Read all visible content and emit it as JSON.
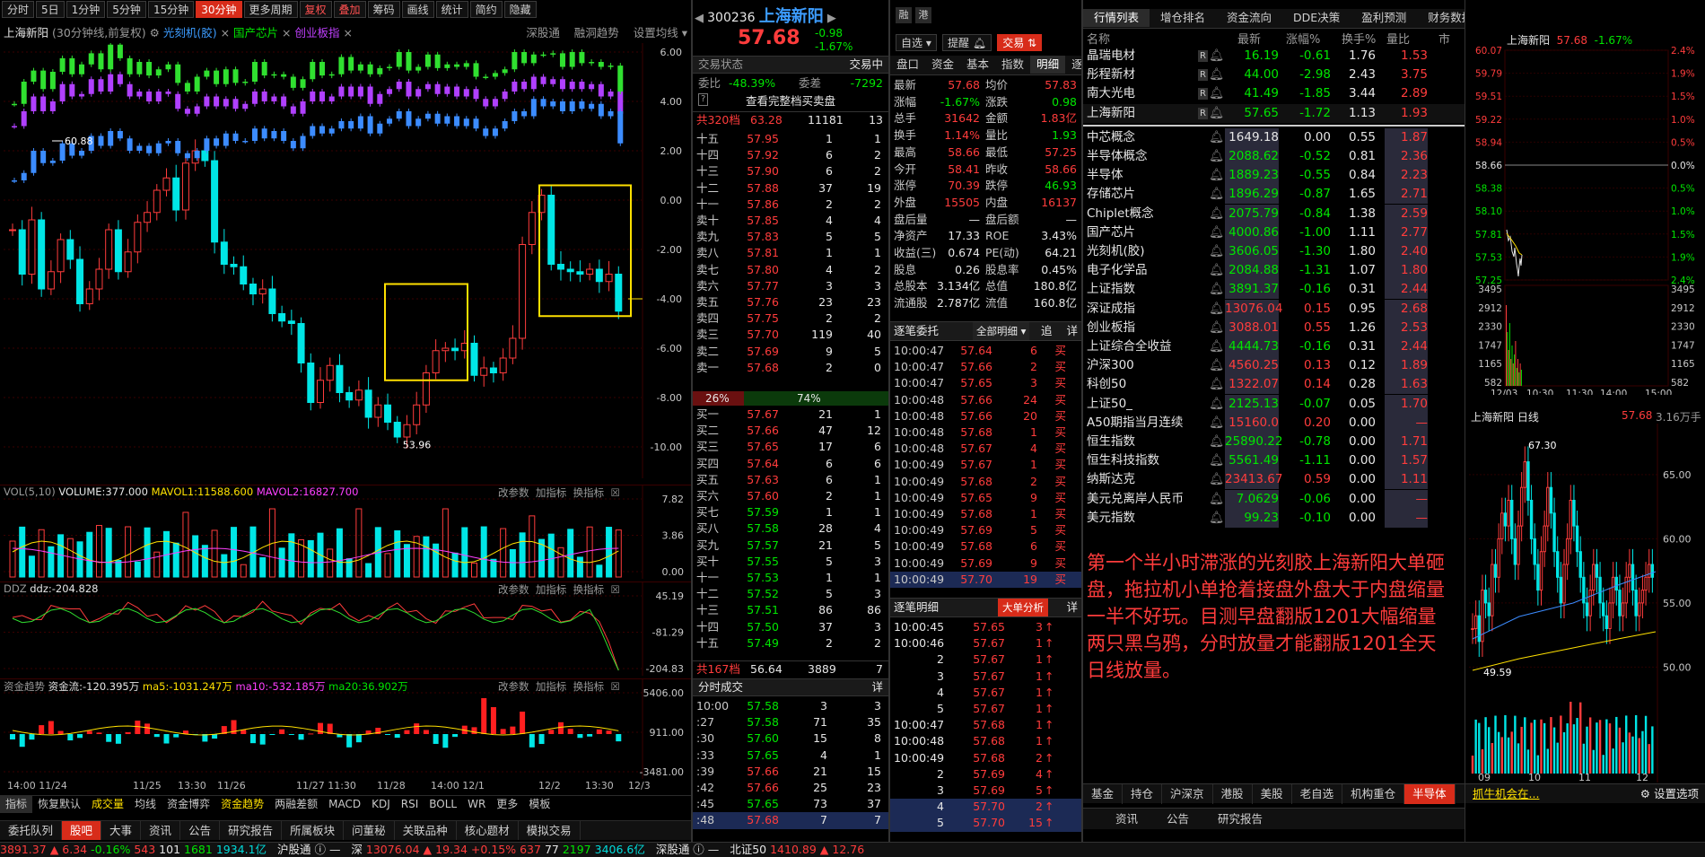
{
  "toolbar": {
    "periods": [
      "分时",
      "5日",
      "1分钟",
      "5分钟",
      "15分钟",
      "30分钟",
      "更多周期"
    ],
    "active_period": "30分钟",
    "adjust": "复权",
    "overlay": "叠加",
    "tools": [
      "筹码",
      "画线",
      "统计",
      "简约",
      "隐藏"
    ]
  },
  "chart_header": {
    "title": "上海新阳",
    "period_note": "(30分钟线,前复权)",
    "ovl1": "光刻机(胶)",
    "ovl2": "国产芯片",
    "ovl3": "创业板指",
    "links": [
      "深股通",
      "融洞趋势",
      "设置均线"
    ]
  },
  "price_axis": [
    "6.00",
    "4.00",
    "2.00",
    "0.00",
    "-2.00",
    "-4.00",
    "-6.00",
    "-8.00",
    "-10.00"
  ],
  "chart_labels": {
    "high": "60.88",
    "low": "53.96"
  },
  "vol": {
    "title": "VOL(5,10)",
    "volume": "VOLUME:377.000",
    "mavol1": "MAVOL1:11588.600",
    "mavol2": "MAVOL2:16827.700",
    "axis": [
      "7.82",
      "3.86",
      "0.00"
    ]
  },
  "ddz": {
    "title": "DDZ",
    "value": "ddz:-204.828",
    "axis": [
      "45.19",
      "-81.29",
      "-204.83"
    ]
  },
  "fund": {
    "title": "资金趋势",
    "flow": "资金流:-120.395万",
    "ma5": "ma5:-1031.247万",
    "ma10": "ma10:-532.185万",
    "ma20": "ma20:36.902万",
    "axis": [
      "5406.00",
      "911.00",
      "-3481.00"
    ]
  },
  "subpanel_links": [
    "改参数",
    "加指标",
    "换指标"
  ],
  "time_axis": [
    "14:00 11/24",
    "11/25",
    "13:30",
    "11/26",
    "11/27 11:30",
    "11/28",
    "14:00 12/1",
    "12/2",
    "13:30",
    "12/3"
  ],
  "indicator_tabs": [
    "指标",
    "恢复默认",
    "成交量",
    "均线",
    "资金博弈",
    "资金趋势",
    "两融差额",
    "MACD",
    "KDJ",
    "RSI",
    "BOLL",
    "WR",
    "更多",
    "模板"
  ],
  "bottom_tabs": [
    "委托队列",
    "股吧",
    "大事",
    "资讯",
    "公告",
    "研究报告",
    "所属板块",
    "问董秘",
    "关联品种",
    "核心题材",
    "模拟交易"
  ],
  "active_bottom_tab": "股吧",
  "stock": {
    "code": "300236",
    "name": "上海新阳",
    "tag1": "融",
    "tag2": "港",
    "price": "57.68",
    "chg": "-0.98",
    "pct": "-1.67%",
    "btn_select": "自选",
    "btn_alert": "提醒",
    "btn_trade": "交易"
  },
  "order_book": {
    "status_label": "交易状态",
    "status": "交易中",
    "wb_label": "委比",
    "wb": "-48.39%",
    "wc_label": "委差",
    "wc": "-7292",
    "full_book": "查看完整档买卖盘",
    "sell_total": {
      "label": "共320档",
      "price": "63.28",
      "vol": "11181",
      "n": "13"
    },
    "sells": [
      [
        "十五",
        "57.95",
        "1",
        "1"
      ],
      [
        "十四",
        "57.92",
        "6",
        "2"
      ],
      [
        "十三",
        "57.90",
        "6",
        "2"
      ],
      [
        "十二",
        "57.88",
        "37",
        "19"
      ],
      [
        "十一",
        "57.86",
        "2",
        "2"
      ],
      [
        "卖十",
        "57.85",
        "4",
        "4"
      ],
      [
        "卖九",
        "57.83",
        "5",
        "5"
      ],
      [
        "卖八",
        "57.81",
        "1",
        "1"
      ],
      [
        "卖七",
        "57.80",
        "4",
        "2"
      ],
      [
        "卖六",
        "57.77",
        "3",
        "3"
      ],
      [
        "卖五",
        "57.76",
        "23",
        "23"
      ],
      [
        "卖四",
        "57.75",
        "2",
        "2"
      ],
      [
        "卖三",
        "57.70",
        "119",
        "40"
      ],
      [
        "卖二",
        "57.69",
        "9",
        "5"
      ],
      [
        "卖一",
        "57.68",
        "2",
        "0"
      ]
    ],
    "ratio_left": "26%",
    "ratio_right": "74%",
    "ratio": 0.26,
    "buys": [
      [
        "买一",
        "57.67",
        "21",
        "1"
      ],
      [
        "买二",
        "57.66",
        "47",
        "12"
      ],
      [
        "买三",
        "57.65",
        "17",
        "6"
      ],
      [
        "买四",
        "57.64",
        "6",
        "6"
      ],
      [
        "买五",
        "57.63",
        "6",
        "1"
      ],
      [
        "买六",
        "57.60",
        "2",
        "1"
      ],
      [
        "买七",
        "57.59",
        "1",
        "1"
      ],
      [
        "买八",
        "57.58",
        "28",
        "4"
      ],
      [
        "买九",
        "57.57",
        "21",
        "5"
      ],
      [
        "买十",
        "57.55",
        "5",
        "3"
      ],
      [
        "十一",
        "57.53",
        "1",
        "1"
      ],
      [
        "十二",
        "57.52",
        "5",
        "3"
      ],
      [
        "十三",
        "57.51",
        "86",
        "86"
      ],
      [
        "十四",
        "57.50",
        "37",
        "3"
      ],
      [
        "十五",
        "57.49",
        "2",
        "2"
      ]
    ],
    "buy_total": {
      "label": "共167档",
      "price": "56.64",
      "vol": "3889",
      "n": "7"
    }
  },
  "ticks_title": "分时成交",
  "detail": "详",
  "ticks": [
    [
      "10:00",
      "57.58",
      "3",
      "3"
    ],
    [
      ":27",
      "57.58",
      "71",
      "35"
    ],
    [
      ":30",
      "57.60",
      "15",
      "8"
    ],
    [
      ":33",
      "57.65",
      "4",
      "1"
    ],
    [
      ":39",
      "57.66",
      "21",
      "15"
    ],
    [
      ":42",
      "57.66",
      "25",
      "23"
    ],
    [
      ":45",
      "57.65",
      "73",
      "37"
    ],
    [
      ":48",
      "57.68",
      "7",
      "7"
    ]
  ],
  "quote_tabs": [
    "盘口",
    "资金",
    "基本",
    "指数",
    "明细",
    "逐笔"
  ],
  "quote": [
    [
      "最新",
      "57.68",
      "均价",
      "57.83"
    ],
    [
      "涨幅",
      "-1.67%",
      "涨跌",
      "0.98"
    ],
    [
      "总手",
      "31642",
      "金额",
      "1.83亿"
    ],
    [
      "换手",
      "1.14%",
      "量比",
      "1.93"
    ],
    [
      "最高",
      "58.66",
      "最低",
      "57.25"
    ],
    [
      "今开",
      "58.41",
      "昨收",
      "58.66"
    ],
    [
      "涨停",
      "70.39",
      "跌停",
      "46.93"
    ],
    [
      "外盘",
      "15505",
      "内盘",
      "16137"
    ],
    [
      "盘后量",
      "—",
      "盘后额",
      "—"
    ],
    [
      "净资产",
      "17.33",
      "ROE",
      "3.43%"
    ],
    [
      "收益(三)",
      "0.674",
      "PE(动)",
      "64.21"
    ],
    [
      "股息",
      "0.26",
      "股息率",
      "0.45%"
    ],
    [
      "总股本",
      "3.134亿",
      "总值",
      "180.8亿"
    ],
    [
      "流通股",
      "2.787亿",
      "流值",
      "160.8亿"
    ]
  ],
  "entrust": {
    "title": "逐笔委托",
    "filter": "全部明细",
    "btn1": "追",
    "btn2": "详",
    "rows": [
      [
        "10:00:47",
        "57.64",
        "6",
        "买"
      ],
      [
        "10:00:47",
        "57.66",
        "2",
        "买"
      ],
      [
        "10:00:47",
        "57.65",
        "3",
        "买"
      ],
      [
        "10:00:48",
        "57.66",
        "24",
        "买"
      ],
      [
        "10:00:48",
        "57.66",
        "20",
        "买"
      ],
      [
        "10:00:48",
        "57.68",
        "1",
        "买"
      ],
      [
        "10:00:48",
        "57.67",
        "4",
        "买"
      ],
      [
        "10:00:49",
        "57.67",
        "1",
        "买"
      ],
      [
        "10:00:49",
        "57.68",
        "2",
        "买"
      ],
      [
        "10:00:49",
        "57.65",
        "9",
        "买"
      ],
      [
        "10:00:49",
        "57.68",
        "1",
        "买"
      ],
      [
        "10:00:49",
        "57.69",
        "5",
        "买"
      ],
      [
        "10:00:49",
        "57.68",
        "6",
        "买"
      ],
      [
        "10:00:49",
        "57.69",
        "9",
        "买"
      ],
      [
        "10:00:49",
        "57.70",
        "19",
        "买"
      ]
    ]
  },
  "trade_detail": {
    "title": "逐笔明细",
    "btn": "大单分析",
    "detail": "详",
    "rows": [
      [
        "10:00:45",
        "57.65",
        "3"
      ],
      [
        "10:00:46",
        "57.67",
        "1"
      ],
      [
        "2",
        "57.67",
        "1"
      ],
      [
        "3",
        "57.67",
        "1"
      ],
      [
        "4",
        "57.67",
        "1"
      ],
      [
        "5",
        "57.67",
        "1"
      ],
      [
        "10:00:47",
        "57.68",
        "1"
      ],
      [
        "10:00:48",
        "57.68",
        "1"
      ],
      [
        "10:00:49",
        "57.68",
        "2"
      ],
      [
        "2",
        "57.69",
        "4"
      ],
      [
        "3",
        "57.69",
        "5"
      ],
      [
        "4",
        "57.70",
        "2"
      ],
      [
        "5",
        "57.70",
        "15"
      ]
    ]
  },
  "watch_tabs": [
    "行情列表",
    "增仓排名",
    "资金流向",
    "DDE决策",
    "盈利预测",
    "财务数据",
    "阶段统计",
    "更多"
  ],
  "watch_header": [
    "名称",
    "最新",
    "涨幅%",
    "换手%",
    "量比",
    "市"
  ],
  "watch_stocks": [
    [
      "晶瑞电材",
      "16.19",
      "-0.61",
      "1.76",
      "1.53"
    ],
    [
      "彤程新材",
      "44.00",
      "-2.98",
      "2.43",
      "3.75"
    ],
    [
      "南大光电",
      "41.49",
      "-1.85",
      "3.44",
      "2.89"
    ],
    [
      "上海新阳",
      "57.65",
      "-1.72",
      "1.13",
      "1.93"
    ]
  ],
  "watch_index": [
    [
      "中芯概念",
      "1649.18",
      "0.00",
      "0.55",
      "1.87"
    ],
    [
      "半导体概念",
      "2088.62",
      "-0.52",
      "0.81",
      "2.36"
    ],
    [
      "半导体",
      "1889.23",
      "-0.55",
      "0.84",
      "2.23"
    ],
    [
      "存储芯片",
      "1896.29",
      "-0.87",
      "1.65",
      "2.71"
    ],
    [
      "Chiplet概念",
      "2075.79",
      "-0.84",
      "1.38",
      "2.59"
    ],
    [
      "国产芯片",
      "4000.86",
      "-1.00",
      "1.11",
      "2.77"
    ],
    [
      "光刻机(胶)",
      "3606.05",
      "-1.30",
      "1.80",
      "2.40"
    ],
    [
      "电子化学品",
      "2084.88",
      "-1.31",
      "1.07",
      "1.80"
    ],
    [
      "上证指数",
      "3891.37",
      "-0.16",
      "0.31",
      "2.44"
    ],
    [
      "深证成指",
      "13076.04",
      "0.15",
      "0.95",
      "2.68"
    ],
    [
      "创业板指",
      "3088.01",
      "0.55",
      "1.26",
      "2.53"
    ],
    [
      "上证综合全收益",
      "4444.73",
      "-0.16",
      "0.31",
      "2.44"
    ],
    [
      "沪深300",
      "4560.25",
      "0.13",
      "0.12",
      "1.89"
    ],
    [
      "科创50",
      "1322.07",
      "0.14",
      "0.28",
      "1.63"
    ],
    [
      "上证50_",
      "2125.13",
      "-0.07",
      "0.05",
      "1.70"
    ],
    [
      "A50期指当月连续",
      "15160.0",
      "0.20",
      "0.00",
      "—"
    ],
    [
      "恒生指数",
      "25890.22",
      "-0.78",
      "0.00",
      "1.71"
    ],
    [
      "恒生科技指数",
      "5561.49",
      "-1.11",
      "0.00",
      "1.57"
    ],
    [
      "纳斯达克",
      "23413.67",
      "0.59",
      "0.00",
      "1.11"
    ],
    [
      "美元兑离岸人民币",
      "7.0629",
      "-0.06",
      "0.00",
      "—"
    ],
    [
      "美元指数",
      "99.23",
      "-0.10",
      "0.00",
      "—"
    ]
  ],
  "note": "第一个半小时滞涨的光刻胶上海新阳大单砸盘，拖拉机小单抢着接盘外盘大于内盘缩量一半不好玩。目测早盘翻版1201大幅缩量两只黑乌鸦，分时放量才能翻版1201全天日线放量。",
  "mini_intraday": {
    "title": "上海新阳",
    "price": "57.68",
    "pct": "-1.67%",
    "left_axis": [
      "60.07",
      "59.79",
      "59.51",
      "59.22",
      "58.94",
      "58.66",
      "58.38",
      "58.10",
      "57.81",
      "57.53",
      "57.25"
    ],
    "right_axis": [
      "2.4%",
      "1.9%",
      "1.5%",
      "1.0%",
      "0.5%",
      "0.0%",
      "0.5%",
      "1.0%",
      "1.5%",
      "1.9%",
      "2.4%"
    ],
    "vol_axis": [
      "3495",
      "2912",
      "2330",
      "1747",
      "1165",
      "582"
    ],
    "times": [
      "12/03",
      "10:30",
      "11:30",
      "14:00",
      "15:00"
    ]
  },
  "mini_daily": {
    "title": "上海新阳",
    "type": "日线",
    "price": "57.68",
    "vol": "3.16万手",
    "high": "67.30",
    "low": "49.59",
    "axis": [
      "65.00",
      "60.00",
      "55.00",
      "50.00"
    ],
    "months": [
      "09",
      "10",
      "11",
      "12"
    ]
  },
  "right_bottom_tabs": [
    "基金",
    "持仓",
    "沪深京",
    "港股",
    "美股",
    "老自选",
    "机构重仓",
    "半导体"
  ],
  "active_right_tab": "半导体",
  "ticker_text": "抓牛机会在...",
  "settings": "设置选项",
  "news_tabs": [
    "资讯",
    "公告",
    "研究报告"
  ],
  "status_bar": {
    "sh": "3891.37",
    "sh_chg": "6.34",
    "sh_pct": "-0.16%",
    "n1": "543",
    "n2": "101",
    "n3": "1681",
    "amt": "1934.1亿",
    "hk1": "沪股通",
    "sz_label": "深",
    "sz": "13076.04",
    "sz_chg": "19.34",
    "sz_pct": "+0.15%",
    "n4": "637",
    "n5": "77",
    "n6": "2197",
    "amt2": "3406.6亿",
    "hk2": "深股通",
    "bz_label": "北证50",
    "bz": "1410.89",
    "bz_chg": "12.76"
  },
  "colors": {
    "up": "#ff3c3c",
    "down": "#00e600",
    "cyan": "#00dcdc",
    "yellow": "#ffe000",
    "bg": "#000000",
    "accent": "#d82c1a"
  }
}
